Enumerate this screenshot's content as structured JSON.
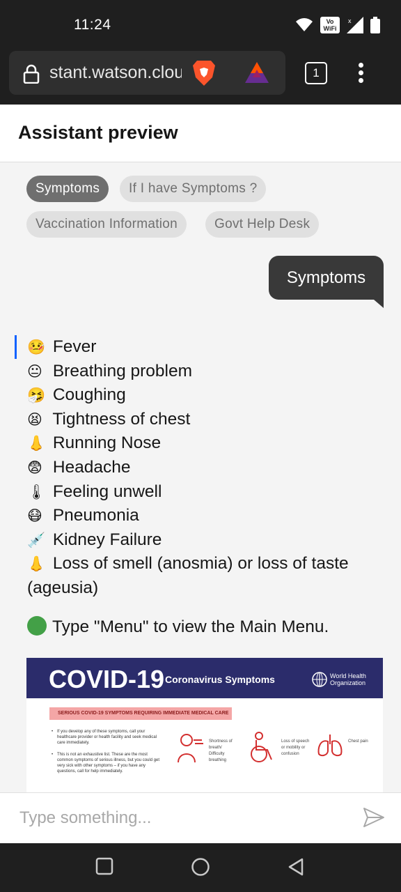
{
  "status_bar": {
    "time": "11:24",
    "volte_label": "Vo\nWiFi"
  },
  "browser": {
    "url": "stant.watson.cloud.ibm.com",
    "tab_count": "1"
  },
  "header": {
    "title": "Assistant preview"
  },
  "chips": [
    {
      "label": "Symptoms",
      "selected": true
    },
    {
      "label": "If I have Symptoms ?",
      "selected": false
    },
    {
      "label": "Vaccination Information",
      "selected": false
    },
    {
      "label": "Govt Help Desk",
      "selected": false
    }
  ],
  "user_message": "Symptoms",
  "bot_message": {
    "symptoms": [
      {
        "emoji": "🤒",
        "text": "Fever"
      },
      {
        "emoji": "😐",
        "text": "Breathing problem"
      },
      {
        "emoji": "🤧",
        "text": "Coughing"
      },
      {
        "emoji": "😫",
        "text": "Tightness of chest"
      },
      {
        "emoji": "👃",
        "text": "Running Nose"
      },
      {
        "emoji": "😨",
        "text": "Headache"
      },
      {
        "emoji": "🌡",
        "text": "Feeling unwell"
      },
      {
        "emoji": "😷",
        "text": "Pneumonia"
      },
      {
        "emoji": "💉",
        "text": "Kidney Failure"
      },
      {
        "emoji": "👃",
        "text": "Loss of smell (anosmia) or loss of taste (ageusia)"
      }
    ],
    "menu_hint": "Type \"Menu\" to view the Main Menu."
  },
  "infographic": {
    "title": "COVID-19",
    "subtitle": "Coronavirus Symptoms",
    "org": "World Health Organization",
    "banner": "SERIOUS COVID-19 SYMPTOMS REQUIRING IMMEDIATE MEDICAL CARE",
    "bullet_1": "If you develop any of these symptoms, call your healthcare provider or health facility and seek medical care immediately.",
    "bullet_2": "This is not an exhaustive list. These are the most common symptoms of serious illness, but you could get very sick with other symptoms – if you have any questions, call for help immediately.",
    "symptom_1": "Shortness of breath/ Difficulty breathing",
    "symptom_2": "Loss of speech or mobility or confusion",
    "symptom_3": "Chest pain"
  },
  "input": {
    "placeholder": "Type something..."
  },
  "colors": {
    "accent": "#0f62fe",
    "bubble": "#393939",
    "chip_selected": "#6f6f6f",
    "who_blue": "#2b2c6b"
  }
}
